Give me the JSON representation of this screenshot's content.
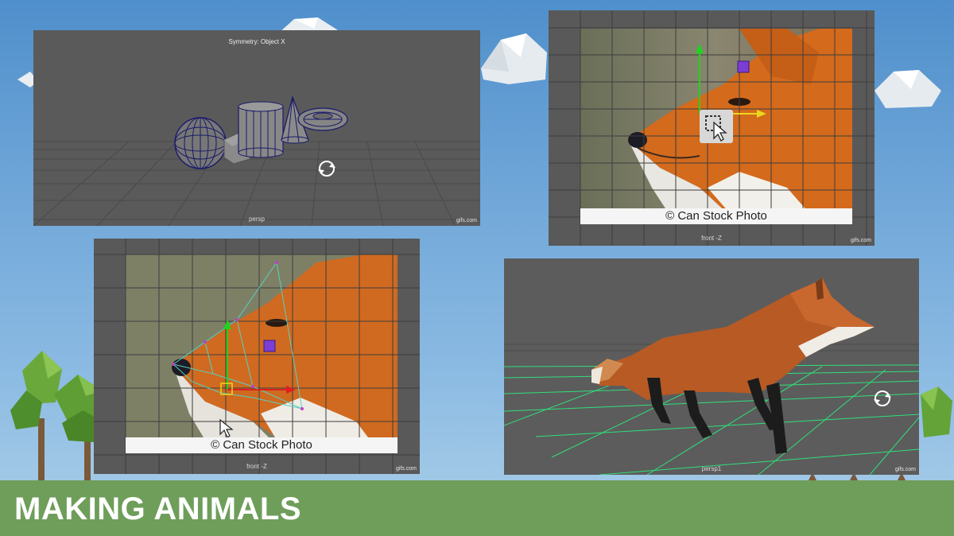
{
  "title": "MAKING ANIMALS",
  "colors": {
    "sky_top": "#4f8fcb",
    "sky_bottom": "#9fc7e6",
    "grass": "#6e9e5a",
    "viewport": "#595959",
    "grid": "#474747",
    "green_grid": "#2ee07a"
  },
  "panels": {
    "top_left": {
      "header": "Symmetry:  Object X",
      "camera": "persp",
      "watermark": "gifs.com"
    },
    "top_right": {
      "stock": "© Can Stock Photo",
      "camera": "front -Z",
      "watermark": "gifs.com"
    },
    "bottom_left": {
      "stock": "© Can Stock Photo",
      "camera": "front -Z",
      "watermark": "gifs.com"
    },
    "bottom_right": {
      "camera": "persp1",
      "watermark": "gifs.com"
    }
  },
  "icons": [
    "rotate-icon",
    "cursor-arrow-icon",
    "select-tool-icon",
    "move-manipulator-icon"
  ]
}
